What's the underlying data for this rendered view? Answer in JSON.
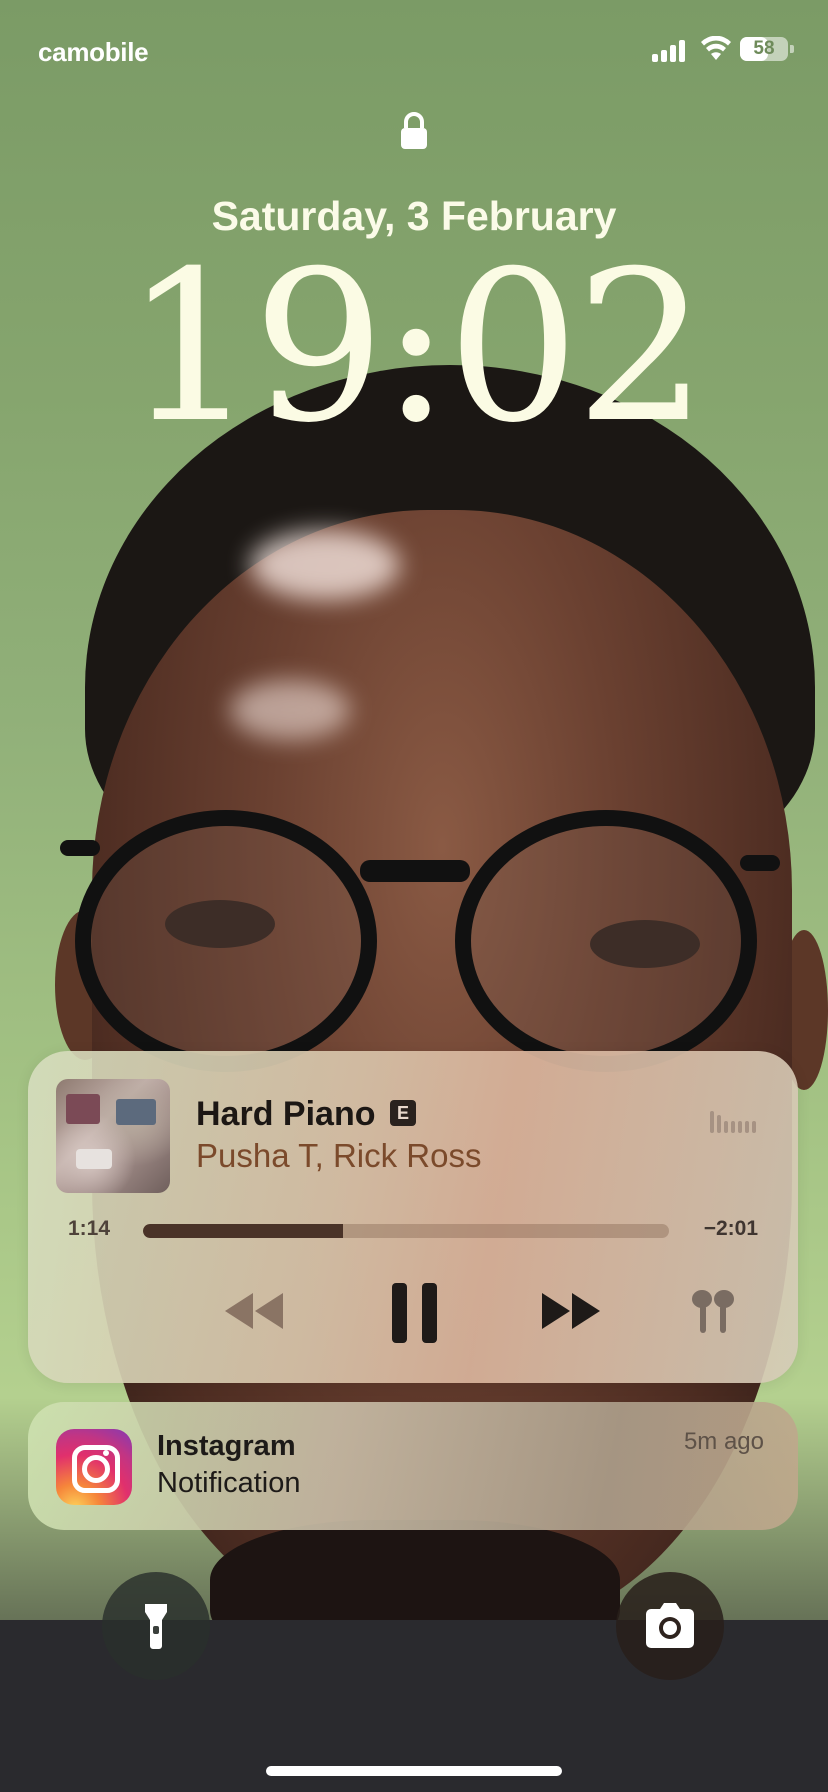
{
  "status_bar": {
    "carrier": "camobile",
    "battery_percent": "58",
    "signal_icon": "cellular-signal-icon",
    "wifi_icon": "wifi-icon"
  },
  "lock_screen": {
    "date": "Saturday, 3 February",
    "time": "19:02"
  },
  "now_playing": {
    "title": "Hard Piano",
    "explicit_badge": "E",
    "artist": "Pusha T, Rick Ross",
    "elapsed": "1:14",
    "remaining": "−2:01",
    "progress_fraction": 0.38,
    "controls": [
      "rewind-icon",
      "pause-icon",
      "fast-forward-icon",
      "airpods-icon"
    ]
  },
  "notification": {
    "app": "Instagram",
    "body": "Notification",
    "time_ago": "5m ago"
  },
  "quick_actions": [
    "flashlight-icon",
    "camera-icon"
  ],
  "colors": {
    "wallpaper_green": "#86a46c",
    "clock_text": "#fbfbe4",
    "artist_text": "#7b4a2b"
  }
}
